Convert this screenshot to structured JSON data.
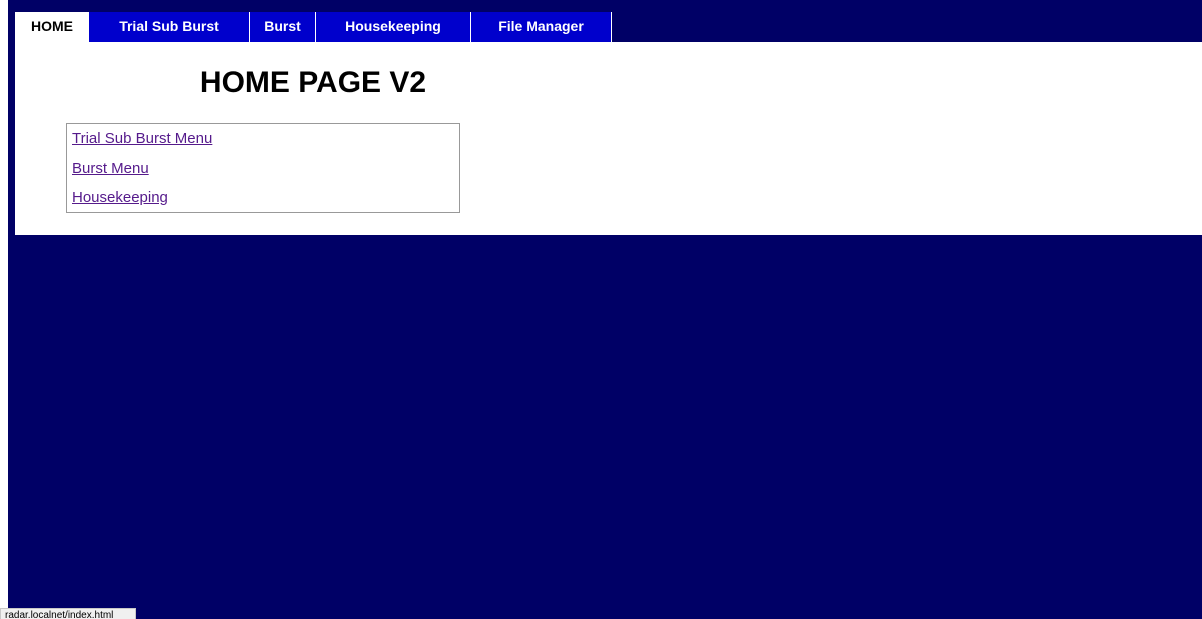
{
  "tabs": [
    {
      "label": "HOME",
      "active": true
    },
    {
      "label": "Trial Sub Burst",
      "active": false
    },
    {
      "label": "Burst",
      "active": false
    },
    {
      "label": "Housekeeping",
      "active": false
    },
    {
      "label": "File Manager",
      "active": false
    }
  ],
  "page": {
    "title": "HOME PAGE V2"
  },
  "links": [
    "Trial Sub Burst Menu",
    "Burst Menu",
    "Housekeeping"
  ],
  "status_bar": {
    "url": "radar.localnet/index.html"
  },
  "colors": {
    "background": "#000066",
    "tab_inactive": "#0000cc",
    "tab_active": "#ffffff",
    "link_visited": "#551a8b"
  }
}
